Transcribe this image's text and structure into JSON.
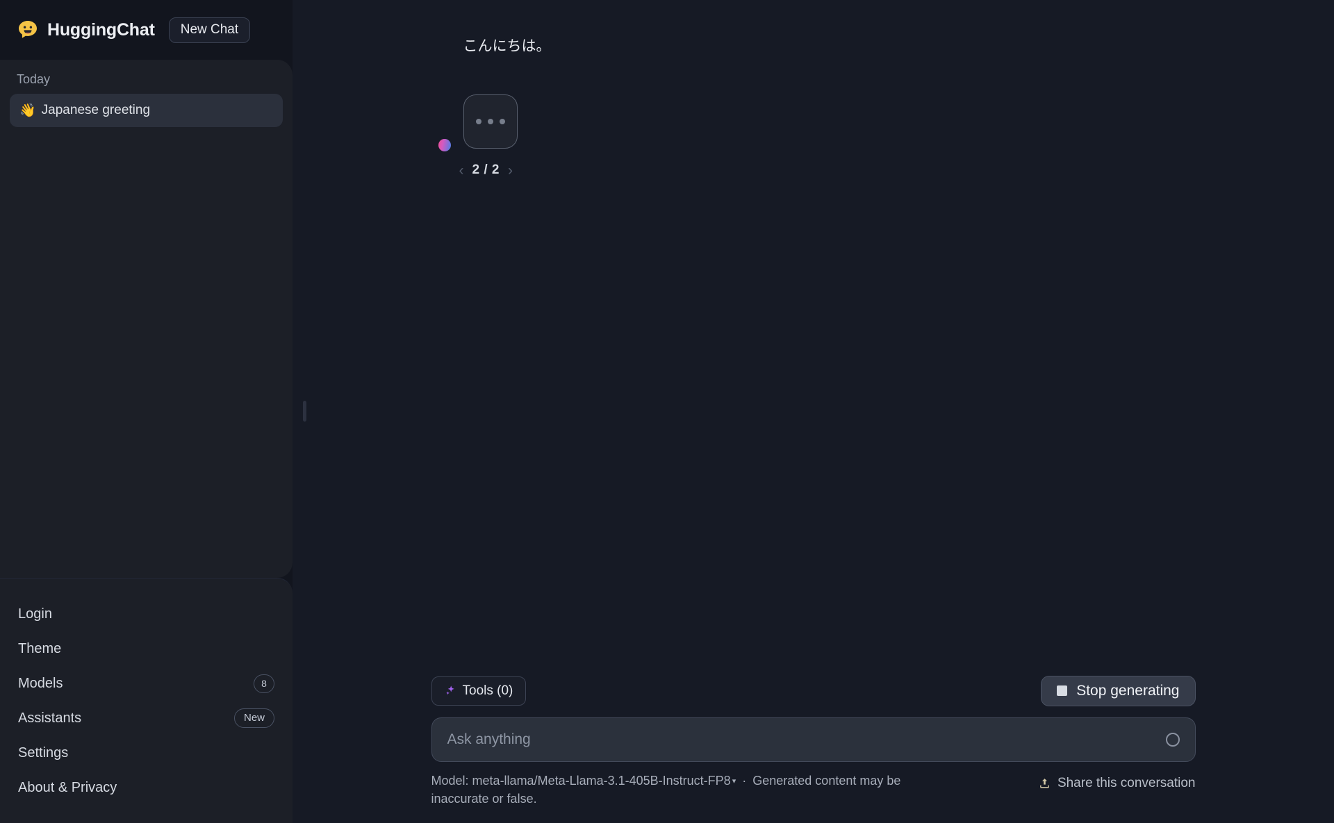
{
  "app": {
    "brand_name": "HuggingChat",
    "logo_icon": "speech-bubble-smiley-icon",
    "new_chat_label": "New Chat"
  },
  "sidebar": {
    "group_label": "Today",
    "conversations": [
      {
        "emoji": "👋",
        "title": "Japanese greeting",
        "active": true
      }
    ],
    "nav_items": [
      {
        "label": "Login",
        "badge": ""
      },
      {
        "label": "Theme",
        "badge": ""
      },
      {
        "label": "Models",
        "badge": "8"
      },
      {
        "label": "Assistants",
        "badge": "New"
      },
      {
        "label": "Settings",
        "badge": ""
      },
      {
        "label": "About & Privacy",
        "badge": ""
      }
    ]
  },
  "conversation": {
    "user_message": "こんにちは。",
    "assistant_status": "loading",
    "loading_dots": "•••",
    "pager": {
      "prev_icon": "chevron-left-icon",
      "next_icon": "chevron-right-icon",
      "count": "2 / 2"
    }
  },
  "composer": {
    "tools_label": "Tools (0)",
    "tools_icon": "sparkle-icon",
    "stop_label": "Stop generating",
    "stop_icon": "stop-square-icon",
    "input_value": "",
    "input_placeholder": "Ask anything",
    "spinner_icon": "loading-ring-icon",
    "model_prefix": "Model:",
    "model_name": "meta-llama/Meta-Llama-3.1-405B-Instruct-FP8",
    "model_caret": "▾",
    "separator": "·",
    "disclaimer": "Generated content may be inaccurate or false.",
    "share_label": "Share this conversation",
    "share_icon": "share-upload-icon"
  },
  "colors": {
    "page_bg": "#161a25",
    "sidebar_bg": "#12151e",
    "panel_bg": "#1c1f27",
    "active_item": "#2b303c",
    "accent_purple": "#a463f2",
    "brand_yellow": "#f5c346",
    "avatar_gradient_start": "#ef4f96",
    "avatar_gradient_end": "#4b7fe8",
    "share_icon_color": "#d4c9a8"
  }
}
